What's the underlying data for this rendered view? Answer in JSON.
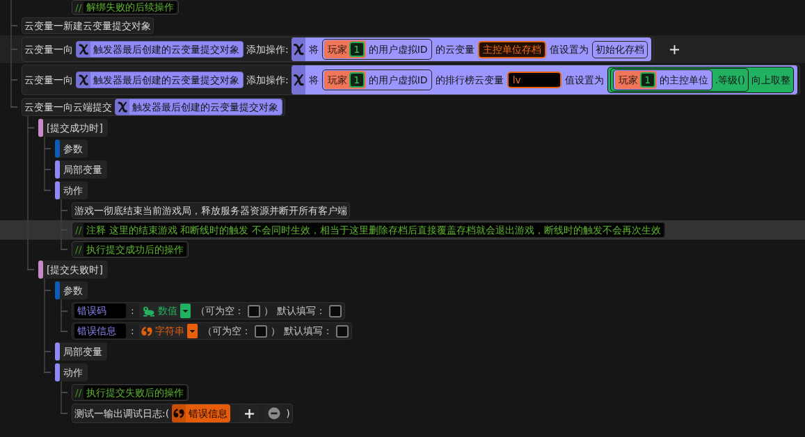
{
  "top_fragment": {
    "marker": "//",
    "text": "解绑失败的后续操作"
  },
  "tree": [
    {
      "kind": "statement",
      "selected": false,
      "hovered": false,
      "parts": [
        {
          "kind": "text",
          "text": "云变量一新建云变量提交对象"
        }
      ]
    },
    {
      "kind": "statement",
      "selected": false,
      "hovered": true,
      "parts": [
        {
          "kind": "text",
          "text": "云变量一向"
        },
        {
          "kind": "variable",
          "text": "触发器最后创建的云变量提交对象"
        },
        {
          "kind": "text",
          "text": "添加操作:"
        },
        {
          "kind": "block",
          "parts": [
            {
              "kind": "text",
              "text": "将"
            },
            {
              "kind": "group",
              "parts": [
                {
                  "kind": "player",
                  "text": "玩家",
                  "number": "1"
                },
                {
                  "kind": "text",
                  "text": "的用户虚拟ID"
                }
              ]
            },
            {
              "kind": "text",
              "text": "的云变量"
            },
            {
              "kind": "cloud_var",
              "text": "主控单位存档"
            },
            {
              "kind": "text",
              "text": "值设置为"
            },
            {
              "kind": "literal",
              "text": "初始化存档"
            }
          ]
        }
      ]
    },
    {
      "kind": "statement",
      "selected": false,
      "hovered": false,
      "parts": [
        {
          "kind": "text",
          "text": "云变量一向"
        },
        {
          "kind": "variable",
          "text": "触发器最后创建的云变量提交对象"
        },
        {
          "kind": "text",
          "text": "添加操作:"
        },
        {
          "kind": "block",
          "parts": [
            {
              "kind": "text",
              "text": "将"
            },
            {
              "kind": "group",
              "parts": [
                {
                  "kind": "player",
                  "text": "玩家",
                  "number": "1"
                },
                {
                  "kind": "text",
                  "text": "的用户虚拟ID"
                }
              ]
            },
            {
              "kind": "text",
              "text": "的排行榜云变量"
            },
            {
              "kind": "input",
              "value": "lv"
            },
            {
              "kind": "text",
              "text": "值设置为"
            },
            {
              "kind": "call",
              "parts": [
                {
                  "kind": "call",
                  "parts": [
                    {
                      "kind": "group",
                      "parts": [
                        {
                          "kind": "player",
                          "text": "玩家",
                          "number": "1"
                        },
                        {
                          "kind": "text",
                          "text": "的主控单位"
                        }
                      ]
                    }
                  ],
                  "text": ".等级()"
                }
              ],
              "text": "向上取整"
            }
          ]
        }
      ]
    },
    {
      "kind": "statement",
      "selected": false,
      "hovered": false,
      "parts": [
        {
          "kind": "text",
          "text": "云变量一向云端提交"
        },
        {
          "kind": "variable",
          "text": "触发器最后创建的云变量提交对象"
        }
      ],
      "children": [
        {
          "kind": "section",
          "text": "[提交成功时]",
          "color": "#c98ac7",
          "selected": false,
          "hovered": false,
          "children": [
            {
              "kind": "section",
              "text": "参数",
              "color": "#0b5cb6",
              "selected": false,
              "hovered": false
            },
            {
              "kind": "section",
              "text": "局部变量",
              "color": "#8f89f7",
              "selected": false,
              "hovered": false
            },
            {
              "kind": "section",
              "text": "动作",
              "color": "#8f89f7",
              "selected": false,
              "hovered": false,
              "children": [
                {
                  "kind": "statement",
                  "selected": false,
                  "hovered": false,
                  "parts": [
                    {
                      "kind": "text",
                      "text": "游戏一彻底结束当前游戏局，释放服务器资源并断开所有客户端"
                    }
                  ]
                },
                {
                  "kind": "comment",
                  "marker": "//",
                  "text": "注释 这里的结束游戏 和断线时的触发 不会同时生效，相当于这里删除存档后直接覆盖存档就会退出游戏，断线时的触发不会再次生效",
                  "selected": true,
                  "hovered": false
                },
                {
                  "kind": "comment",
                  "marker": "//",
                  "text": "执行提交成功后的操作",
                  "selected": false,
                  "hovered": false
                }
              ]
            }
          ]
        },
        {
          "kind": "section",
          "text": "[提交失败时]",
          "color": "#c98ac7",
          "selected": false,
          "hovered": false,
          "children": [
            {
              "kind": "section",
              "text": "参数",
              "color": "#0b5cb6",
              "selected": false,
              "hovered": false,
              "children": [
                {
                  "kind": "param",
                  "name": "错误码",
                  "separator": ":",
                  "type": {
                    "kind": "number",
                    "text": "数值"
                  },
                  "nullable_label": "（可为空：",
                  "nullable": false,
                  "nullable_close": "）",
                  "default_label": "默认填写：",
                  "default": false,
                  "selected": false,
                  "hovered": false
                },
                {
                  "kind": "param",
                  "name": "错误信息",
                  "separator": ":",
                  "type": {
                    "kind": "string",
                    "text": "字符串"
                  },
                  "nullable_label": "（可为空：",
                  "nullable": false,
                  "nullable_close": "）",
                  "default_label": "默认填写：",
                  "default": false,
                  "selected": false,
                  "hovered": false
                }
              ]
            },
            {
              "kind": "section",
              "text": "局部变量",
              "color": "#8f89f7",
              "selected": false,
              "hovered": false
            },
            {
              "kind": "section",
              "text": "动作",
              "color": "#8f89f7",
              "selected": false,
              "hovered": false,
              "children": [
                {
                  "kind": "comment",
                  "marker": "//",
                  "text": "执行提交失败后的操作",
                  "selected": false,
                  "hovered": false
                },
                {
                  "kind": "statement",
                  "selected": false,
                  "hovered": false,
                  "parts": [
                    {
                      "kind": "text",
                      "text": "测试一输出调试日志:("
                    },
                    {
                      "kind": "string_ref",
                      "text": "错误信息"
                    },
                    {
                      "kind": "add_button"
                    },
                    {
                      "kind": "remove_button"
                    },
                    {
                      "kind": "text",
                      "text": ")"
                    }
                  ]
                }
              ]
            }
          ]
        }
      ]
    }
  ]
}
